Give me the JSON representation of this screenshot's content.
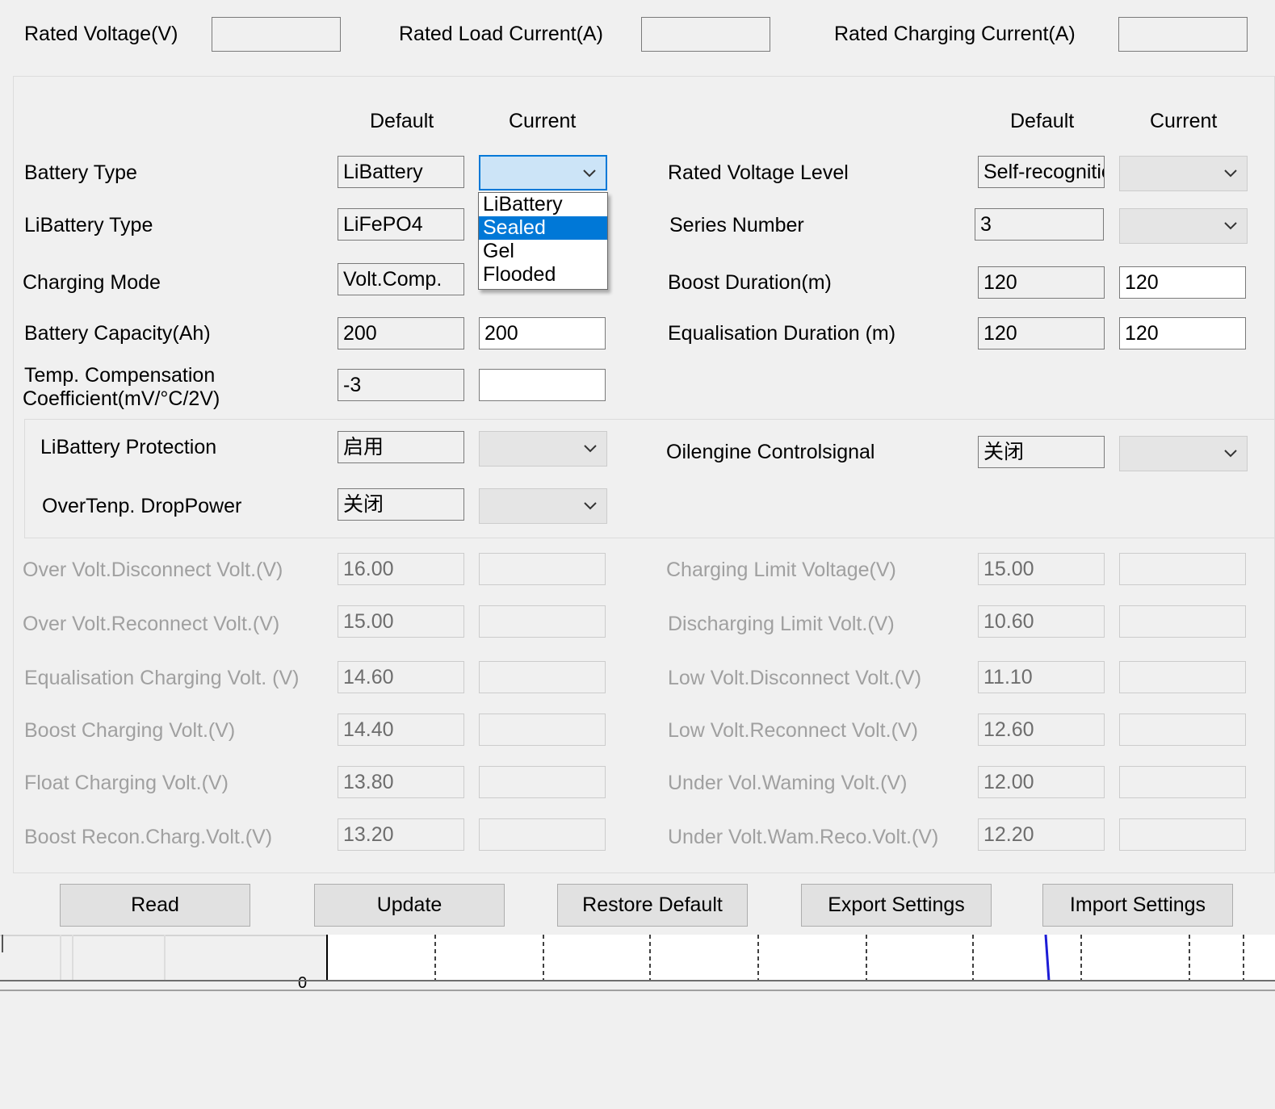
{
  "top": {
    "rated_voltage": "Rated Voltage(V)",
    "rated_load_current": "Rated Load Current(A)",
    "rated_charging_current": "Rated Charging Current(A)"
  },
  "headers": {
    "default": "Default",
    "current": "Current"
  },
  "left": {
    "battery_type": {
      "label": "Battery Type",
      "default": "LiBattery",
      "current": ""
    },
    "libattery_type": {
      "label": "LiBattery Type",
      "default": "LiFePO4"
    },
    "charging_mode": {
      "label": "Charging Mode",
      "default": "Volt.Comp."
    },
    "battery_capacity": {
      "label": "Battery Capacity(Ah)",
      "default": "200",
      "current": "200"
    },
    "temp_comp": {
      "label_line1": "Temp. Compensation",
      "label_line2": "Coefficient(mV/°C/2V)",
      "default": "-3",
      "current": ""
    }
  },
  "right": {
    "rated_voltage_level": {
      "label": "Rated Voltage Level",
      "default": "Self-recognitio"
    },
    "series_number": {
      "label": "Series Number",
      "default": "3"
    },
    "boost_duration": {
      "label": "Boost Duration(m)",
      "default": "120",
      "current": "120"
    },
    "equalisation_duration": {
      "label": "Equalisation Duration (m)",
      "default": "120",
      "current": "120"
    }
  },
  "dropdown": {
    "options": [
      "LiBattery",
      "Sealed",
      "Gel",
      "Flooded"
    ],
    "highlighted_index": 1
  },
  "group": {
    "libattery_protection": {
      "label": "LiBattery Protection",
      "default": "启用"
    },
    "overtemp_droppower": {
      "label": "OverTenp. DropPower",
      "default": "关闭"
    },
    "oilengine_control": {
      "label": "Oilengine Controlsignal",
      "default": "关闭"
    }
  },
  "voltages_left": [
    {
      "label": "Over Volt.Disconnect Volt.(V)",
      "default": "16.00"
    },
    {
      "label": "Over Volt.Reconnect Volt.(V)",
      "default": "15.00"
    },
    {
      "label": "Equalisation Charging Volt. (V)",
      "default": "14.60"
    },
    {
      "label": "Boost Charging Volt.(V)",
      "default": "14.40"
    },
    {
      "label": "Float Charging Volt.(V)",
      "default": "13.80"
    },
    {
      "label": "Boost Recon.Charg.Volt.(V)",
      "default": "13.20"
    }
  ],
  "voltages_right": [
    {
      "label": "Charging Limit Voltage(V)",
      "default": "15.00"
    },
    {
      "label": "Discharging Limit Volt.(V)",
      "default": "10.60"
    },
    {
      "label": "Low Volt.Disconnect Volt.(V)",
      "default": "11.10"
    },
    {
      "label": "Low Volt.Reconnect Volt.(V)",
      "default": "12.60"
    },
    {
      "label": "Under Vol.Waming Volt.(V)",
      "default": "12.00"
    },
    {
      "label": "Under Volt.Wam.Reco.Volt.(V)",
      "default": "12.20"
    }
  ],
  "buttons": {
    "read": "Read",
    "update": "Update",
    "restore_default": "Restore Default",
    "export_settings": "Export Settings",
    "import_settings": "Import Settings"
  },
  "chart_strip": {
    "axis_label": "0"
  },
  "colors": {
    "accent": "#0078d7",
    "disabled_text": "#a0a0a0"
  }
}
